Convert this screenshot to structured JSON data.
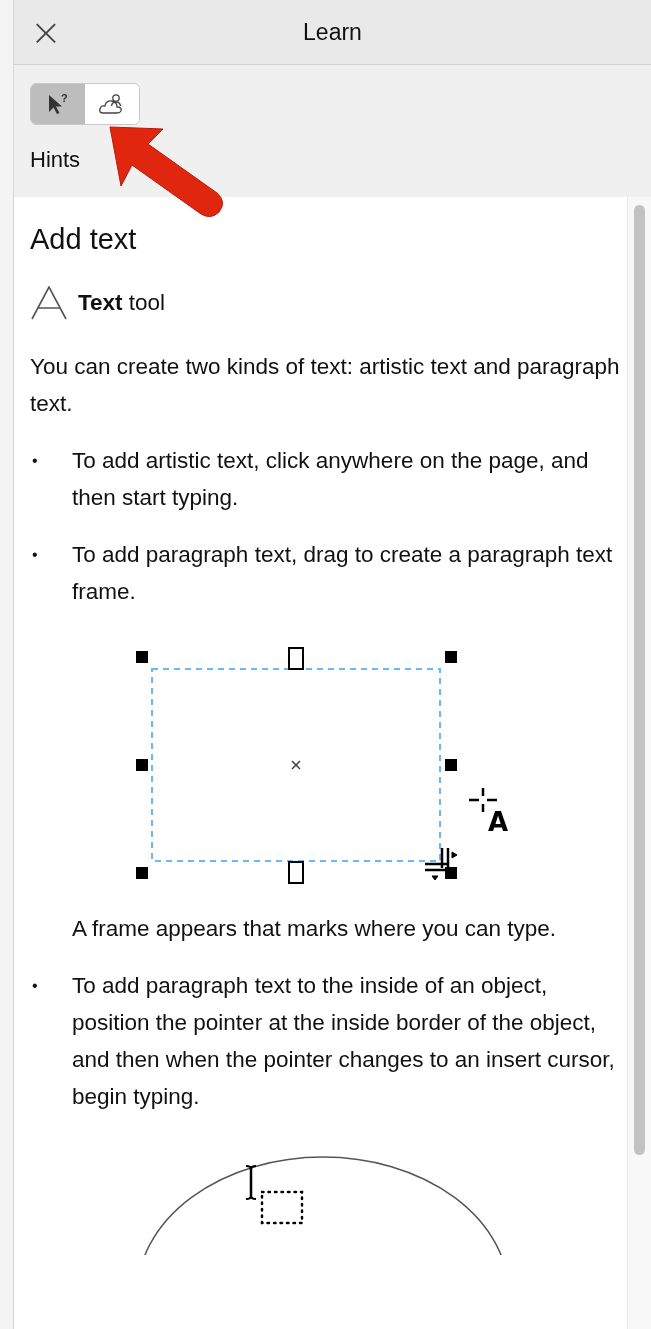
{
  "header": {
    "close_glyph": "×",
    "title": "Learn"
  },
  "mode_buttons": [
    {
      "kind": "hints",
      "selected": true,
      "glyph": "?"
    },
    {
      "kind": "assistant",
      "selected": false
    }
  ],
  "mode_label": "Hints",
  "content": {
    "heading": "Add text",
    "tool_label": "**Text** tool",
    "blocks": [
      {
        "kind": "paragraph",
        "text": "You can create two kinds of text: artistic text and paragraph text."
      },
      {
        "kind": "bullet",
        "bullet": "•",
        "text": "To add artistic text, click anywhere on the page, and then start typing."
      },
      {
        "kind": "bullet",
        "bullet": "•",
        "text": "To add paragraph text, drag to create a paragraph text frame."
      },
      {
        "kind": "frame_figure",
        "cursor_letter": "A"
      },
      {
        "kind": "note",
        "text": "A frame appears that marks where you can type."
      },
      {
        "kind": "bullet",
        "bullet": "•",
        "text": "To add paragraph text to the inside of an object, position the pointer at the inside border of the object, and then when the pointer changes to an insert cursor, begin typing."
      },
      {
        "kind": "ellipse_figure"
      }
    ]
  }
}
